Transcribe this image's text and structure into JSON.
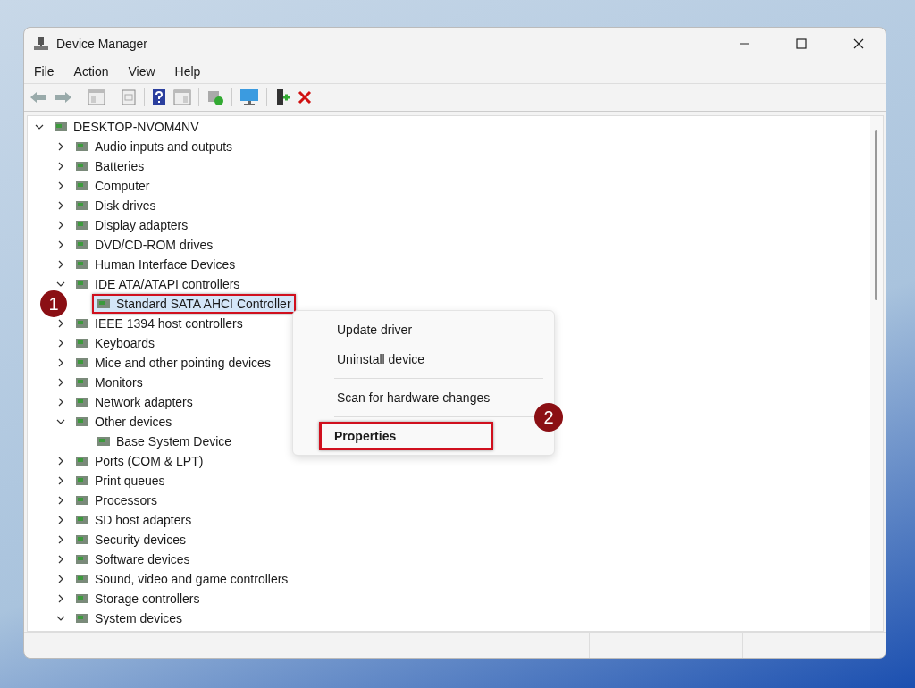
{
  "window": {
    "title": "Device Manager"
  },
  "menu": [
    "File",
    "Action",
    "View",
    "Help"
  ],
  "tree": [
    {
      "label": "DESKTOP-NVOM4NV",
      "expanded": true,
      "selected": false,
      "annotated": false,
      "children": [
        {
          "label": "Audio inputs and outputs",
          "expanded": false,
          "selected": false,
          "annotated": false
        },
        {
          "label": "Batteries",
          "expanded": false,
          "selected": false,
          "annotated": false
        },
        {
          "label": "Computer",
          "expanded": false,
          "selected": false,
          "annotated": false
        },
        {
          "label": "Disk drives",
          "expanded": false,
          "selected": false,
          "annotated": false
        },
        {
          "label": "Display adapters",
          "expanded": false,
          "selected": false,
          "annotated": false
        },
        {
          "label": "DVD/CD-ROM drives",
          "expanded": false,
          "selected": false,
          "annotated": false
        },
        {
          "label": "Human Interface Devices",
          "expanded": false,
          "selected": false,
          "annotated": false
        },
        {
          "label": "IDE ATA/ATAPI controllers",
          "expanded": true,
          "selected": false,
          "annotated": false,
          "children": [
            {
              "label": "Standard SATA AHCI Controller",
              "selected": true,
              "annotated": true
            }
          ]
        },
        {
          "label": "IEEE 1394 host controllers",
          "expanded": false,
          "selected": false,
          "annotated": false
        },
        {
          "label": "Keyboards",
          "expanded": false,
          "selected": false,
          "annotated": false
        },
        {
          "label": "Mice and other pointing devices",
          "expanded": false,
          "selected": false,
          "annotated": false
        },
        {
          "label": "Monitors",
          "expanded": false,
          "selected": false,
          "annotated": false
        },
        {
          "label": "Network adapters",
          "expanded": false,
          "selected": false,
          "annotated": false
        },
        {
          "label": "Other devices",
          "expanded": true,
          "selected": false,
          "annotated": false,
          "children": [
            {
              "label": "Base System Device",
              "selected": false,
              "annotated": false
            }
          ]
        },
        {
          "label": "Ports (COM & LPT)",
          "expanded": false,
          "selected": false,
          "annotated": false
        },
        {
          "label": "Print queues",
          "expanded": false,
          "selected": false,
          "annotated": false
        },
        {
          "label": "Processors",
          "expanded": false,
          "selected": false,
          "annotated": false
        },
        {
          "label": "SD host adapters",
          "expanded": false,
          "selected": false,
          "annotated": false
        },
        {
          "label": "Security devices",
          "expanded": false,
          "selected": false,
          "annotated": false
        },
        {
          "label": "Software devices",
          "expanded": false,
          "selected": false,
          "annotated": false
        },
        {
          "label": "Sound, video and game controllers",
          "expanded": false,
          "selected": false,
          "annotated": false
        },
        {
          "label": "Storage controllers",
          "expanded": false,
          "selected": false,
          "annotated": false
        },
        {
          "label": "System devices",
          "expanded": true,
          "selected": false,
          "annotated": false
        }
      ]
    }
  ],
  "context_menu": [
    {
      "kind": "item",
      "label": "Update driver",
      "default": false,
      "annotated": false
    },
    {
      "kind": "item",
      "label": "Uninstall device",
      "default": false,
      "annotated": false
    },
    {
      "kind": "separator"
    },
    {
      "kind": "item",
      "label": "Scan for hardware changes",
      "default": false,
      "annotated": false
    },
    {
      "kind": "separator"
    },
    {
      "kind": "item",
      "label": "Properties",
      "default": true,
      "annotated": true
    }
  ],
  "callouts": [
    {
      "label": "1"
    },
    {
      "label": "2"
    }
  ]
}
